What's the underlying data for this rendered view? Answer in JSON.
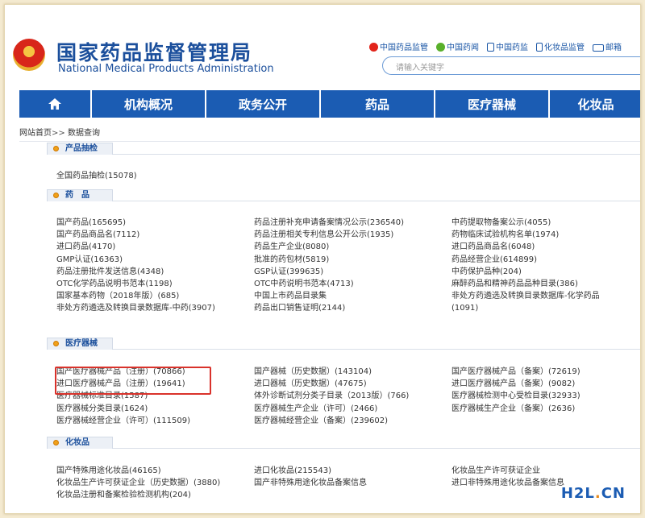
{
  "header": {
    "title_cn": "国家药品监督管理局",
    "title_en": "National Medical Products Administration",
    "links": [
      {
        "label": "中国药品监管",
        "icon": "weibo-icon",
        "color": "#e2231a"
      },
      {
        "label": "中国药闻",
        "icon": "wechat-icon",
        "color": "#59b02b"
      },
      {
        "label": "中国药监",
        "icon": "mobile-icon",
        "color": "#1a56a6"
      },
      {
        "label": "化妆品监管",
        "icon": "phone-icon",
        "color": "#1a56a6"
      },
      {
        "label": "邮箱",
        "icon": "mail-icon",
        "color": "#1a56a6"
      }
    ],
    "search_placeholder": "请输入关键字"
  },
  "nav": {
    "home_icon": "home-icon",
    "items": [
      "机构概况",
      "政务公开",
      "药品",
      "医疗器械",
      "化妆品"
    ]
  },
  "breadcrumb": {
    "home": "网站首页",
    "sep": ">>",
    "current": "数据查询"
  },
  "sections": [
    {
      "title": "产品抽检",
      "cols": [
        [
          "全国药品抽检(15078)"
        ],
        [],
        []
      ]
    },
    {
      "title": "药　品",
      "cols": [
        [
          "国产药品(165695)",
          "国产药品商品名(7112)",
          "进口药品(4170)",
          "GMP认证(16363)",
          "药品注册批件发送信息(4348)",
          "OTC化学药品说明书范本(1198)",
          "国家基本药物（2018年版）(685)",
          "非处方药遴选及转换目录数据库-中药(3907)"
        ],
        [
          "药品注册补充申请备案情况公示(236540)",
          "药品注册相关专利信息公开公示(1935)",
          "药品生产企业(8080)",
          "批准的药包材(5819)",
          "GSP认证(399635)",
          "OTC中药说明书范本(4713)",
          "中国上市药品目录集",
          "药品出口销售证明(2144)"
        ],
        [
          "中药提取物备案公示(4055)",
          "药物临床试验机构名单(1974)",
          "进口药品商品名(6048)",
          "药品经营企业(614899)",
          "中药保护品种(204)",
          "麻醉药品和精神药品品种目录(386)",
          "非处方药遴选及转换目录数据库-化学药品",
          "(1091)"
        ]
      ]
    },
    {
      "title": "医疗器械",
      "cols": [
        [
          "国产医疗器械产品（注册）(70866)",
          "进口医疗器械产品（注册）(19641)",
          "医疗器械标准目录(1587)",
          "医疗器械分类目录(1624)",
          "医疗器械经营企业（许可）(111509)"
        ],
        [
          "国产器械（历史数据）(143104)",
          "进口器械（历史数据）(47675)",
          "体外诊断试剂分类子目录（2013版）(766)",
          "医疗器械生产企业（许可）(2466)",
          "医疗器械经营企业（备案）(239602)"
        ],
        [
          "国产医疗器械产品（备案）(72619)",
          "进口医疗器械产品（备案）(9082)",
          "医疗器械检测中心受检目录(32933)",
          "医疗器械生产企业（备案）(2636)"
        ]
      ]
    },
    {
      "title": "化妆品",
      "cols": [
        [
          "国产特殊用途化妆品(46165)",
          "化妆品生产许可获证企业（历史数据）(3880)",
          "化妆品注册和备案检验检测机构(204)"
        ],
        [
          "进口化妆品(215543)",
          "国产非特殊用途化妆品备案信息"
        ],
        [
          "化妆品生产许可获证企业",
          "进口非特殊用途化妆品备案信息"
        ]
      ]
    }
  ],
  "watermark": {
    "main": "H2L",
    "dot": ".",
    "tld": "CN"
  }
}
